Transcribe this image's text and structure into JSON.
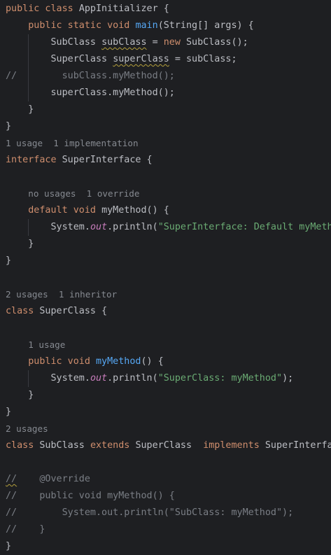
{
  "editor": {
    "lines": [
      {
        "guides": [],
        "tokens": [
          {
            "t": "public class ",
            "c": "kw"
          },
          {
            "t": "AppInitializer {"
          }
        ]
      },
      {
        "guides": [],
        "tokens": [
          {
            "t": "    "
          },
          {
            "t": "public static void ",
            "c": "kw"
          },
          {
            "t": "main",
            "c": "fn"
          },
          {
            "t": "(String[] args) {"
          }
        ]
      },
      {
        "guides": [
          32
        ],
        "tokens": [
          {
            "t": "        SubClass "
          },
          {
            "t": "subClass",
            "c": "squiggle"
          },
          {
            "t": " = "
          },
          {
            "t": "new ",
            "c": "kw"
          },
          {
            "t": "SubClass();"
          }
        ]
      },
      {
        "guides": [
          32
        ],
        "tokens": [
          {
            "t": "        SuperClass "
          },
          {
            "t": "superClass",
            "c": "squiggle"
          },
          {
            "t": " = subClass;"
          }
        ]
      },
      {
        "guides": [
          32
        ],
        "tokens": [
          {
            "t": "//        subClass.myMethod();",
            "c": "cm"
          }
        ]
      },
      {
        "guides": [
          32
        ],
        "tokens": [
          {
            "t": "        superClass.myMethod();"
          }
        ]
      },
      {
        "guides": [],
        "tokens": [
          {
            "t": "    }"
          }
        ]
      },
      {
        "guides": [],
        "tokens": [
          {
            "t": "}"
          }
        ]
      },
      {
        "guides": [],
        "tokens": [
          {
            "t": "1 usage  1 implementation",
            "c": "hint"
          }
        ]
      },
      {
        "guides": [],
        "tokens": [
          {
            "t": "interface ",
            "c": "kw"
          },
          {
            "t": "SuperInterface {"
          }
        ]
      },
      {
        "guides": [],
        "tokens": []
      },
      {
        "guides": [],
        "tokens": [
          {
            "t": "    "
          },
          {
            "t": "no usages  1 override",
            "c": "hint"
          }
        ]
      },
      {
        "guides": [],
        "tokens": [
          {
            "t": "    "
          },
          {
            "t": "default void ",
            "c": "kw"
          },
          {
            "t": "myMethod() {"
          }
        ]
      },
      {
        "guides": [
          32
        ],
        "tokens": [
          {
            "t": "        System."
          },
          {
            "t": "out",
            "c": "static-field"
          },
          {
            "t": ".println("
          },
          {
            "t": "\"SuperInterface: Default myMethod\"",
            "c": "str"
          },
          {
            "t": ");"
          }
        ]
      },
      {
        "guides": [],
        "tokens": [
          {
            "t": "    }"
          }
        ]
      },
      {
        "guides": [],
        "tokens": [
          {
            "t": "}"
          }
        ]
      },
      {
        "guides": [],
        "tokens": []
      },
      {
        "guides": [],
        "tokens": [
          {
            "t": "2 usages  1 inheritor",
            "c": "hint"
          }
        ]
      },
      {
        "guides": [],
        "tokens": [
          {
            "t": "class ",
            "c": "kw"
          },
          {
            "t": "SuperClass {"
          }
        ]
      },
      {
        "guides": [],
        "tokens": []
      },
      {
        "guides": [],
        "tokens": [
          {
            "t": "    "
          },
          {
            "t": "1 usage",
            "c": "hint"
          }
        ]
      },
      {
        "guides": [],
        "tokens": [
          {
            "t": "    "
          },
          {
            "t": "public void ",
            "c": "kw"
          },
          {
            "t": "myMethod",
            "c": "fn"
          },
          {
            "t": "() {"
          }
        ]
      },
      {
        "guides": [
          32
        ],
        "tokens": [
          {
            "t": "        System."
          },
          {
            "t": "out",
            "c": "static-field"
          },
          {
            "t": ".println("
          },
          {
            "t": "\"SuperClass: myMethod\"",
            "c": "str"
          },
          {
            "t": ");"
          }
        ]
      },
      {
        "guides": [],
        "tokens": [
          {
            "t": "    }"
          }
        ]
      },
      {
        "guides": [],
        "tokens": [
          {
            "t": "}"
          }
        ]
      },
      {
        "guides": [],
        "tokens": [
          {
            "t": "2 usages",
            "c": "hint"
          }
        ]
      },
      {
        "guides": [],
        "tokens": [
          {
            "t": "class ",
            "c": "kw"
          },
          {
            "t": "SubClass "
          },
          {
            "t": "extends ",
            "c": "kw"
          },
          {
            "t": "SuperClass  "
          },
          {
            "t": "implements ",
            "c": "kw"
          },
          {
            "t": "SuperInterface {"
          }
        ]
      },
      {
        "guides": [],
        "tokens": []
      },
      {
        "guides": [],
        "tokens": [
          {
            "t": "//",
            "c": "cm squiggle"
          },
          {
            "t": "    ",
            "c": "cm"
          },
          {
            "t": "@Override",
            "c": "cm"
          }
        ]
      },
      {
        "guides": [],
        "tokens": [
          {
            "t": "//    public void myMethod() {",
            "c": "cm"
          }
        ]
      },
      {
        "guides": [],
        "tokens": [
          {
            "t": "//        System.out.println(\"SubClass: myMethod\");",
            "c": "cm"
          }
        ]
      },
      {
        "guides": [],
        "tokens": [
          {
            "t": "//    }",
            "c": "cm"
          }
        ]
      },
      {
        "guides": [],
        "tokens": [
          {
            "t": "}"
          }
        ]
      }
    ]
  }
}
